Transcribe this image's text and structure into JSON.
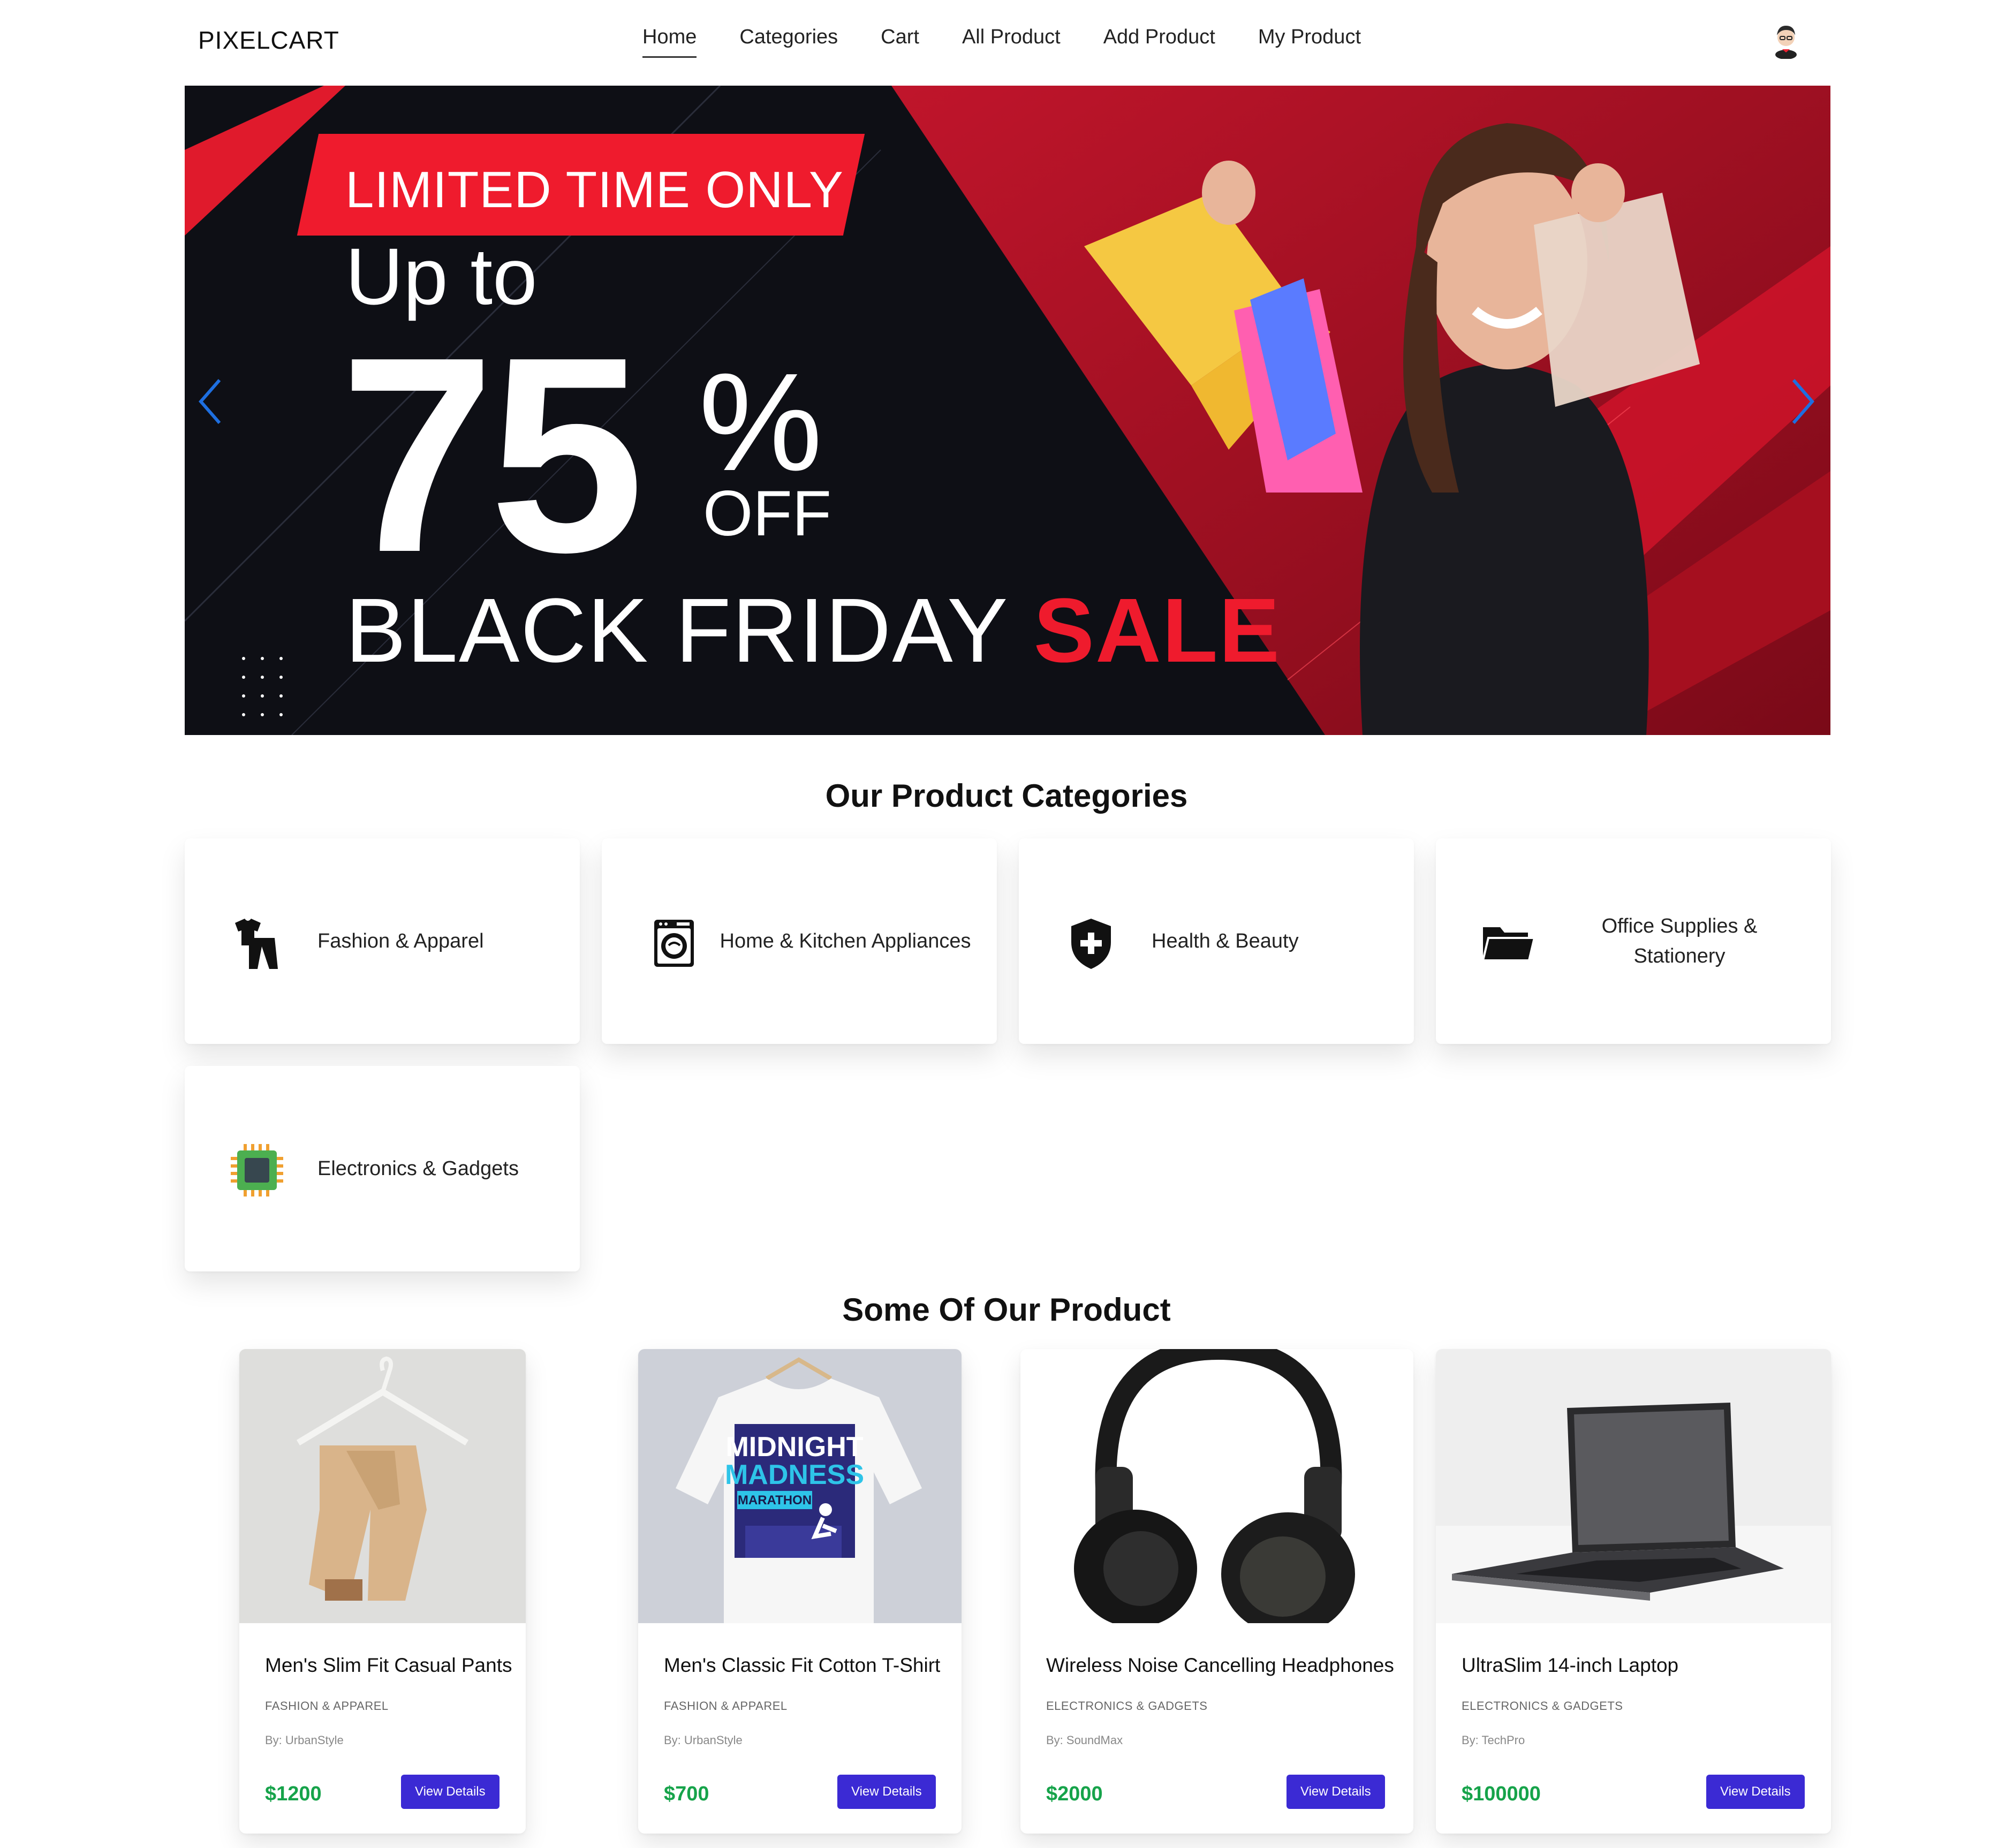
{
  "brand": "PIXELCART",
  "nav": {
    "items": [
      {
        "label": "Home",
        "active": true
      },
      {
        "label": "Categories"
      },
      {
        "label": "Cart"
      },
      {
        "label": "All Product"
      },
      {
        "label": "Add Product"
      },
      {
        "label": "My Product"
      }
    ]
  },
  "hero": {
    "ribbon": "LIMITED TIME ONLY",
    "upto": "Up to",
    "discount": "75",
    "percent": "%",
    "off": "OFF",
    "sale_prefix": "BLACK FRIDAY",
    "sale_word": "SALE",
    "colors": {
      "accent": "#ef1b2d",
      "dark": "#0e0f15",
      "arrow": "#1e6fe0"
    }
  },
  "categories": {
    "title": "Our Product Categories",
    "items": [
      {
        "label": "Fashion & Apparel",
        "icon": "clothes-icon"
      },
      {
        "label": "Home & Kitchen Appliances",
        "icon": "washing-machine-icon"
      },
      {
        "label": "Health & Beauty",
        "icon": "medical-shield-icon"
      },
      {
        "label": "Office Supplies & Stationery",
        "icon": "folder-icon"
      },
      {
        "label": "Electronics & Gadgets",
        "icon": "chip-icon"
      }
    ]
  },
  "products": {
    "title": "Some Of Our Product",
    "button_label": "View Details",
    "items": [
      {
        "name": "Men's Slim Fit Casual Pants",
        "category": "FASHION & APPAREL",
        "by": "By: UrbanStyle",
        "price": "$1200"
      },
      {
        "name": "Men's Classic Fit Cotton T-Shirt",
        "category": "FASHION & APPAREL",
        "by": "By: UrbanStyle",
        "price": "$700",
        "shirt_print": [
          "MIDNIGHT",
          "MADNESS",
          "MARATHON"
        ]
      },
      {
        "name": "Wireless Noise Cancelling Headphones",
        "category": "ELECTRONICS & GADGETS",
        "by": "By: SoundMax",
        "price": "$2000"
      },
      {
        "name": "UltraSlim 14-inch Laptop",
        "category": "ELECTRONICS & GADGETS",
        "by": "By: TechPro",
        "price": "$100000"
      }
    ],
    "colors": {
      "price": "#16a34a",
      "button": "#3b2ad4"
    }
  }
}
